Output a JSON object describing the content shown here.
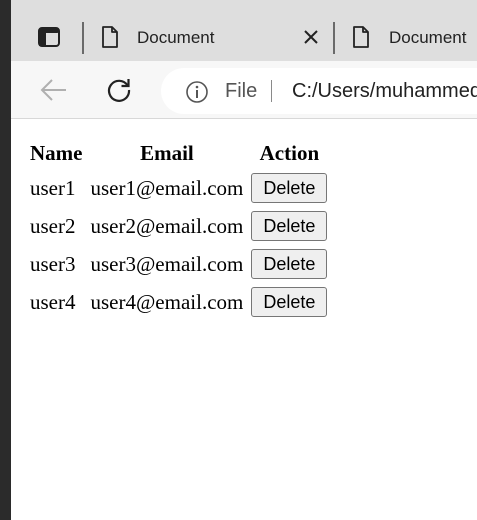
{
  "browser": {
    "tabs": [
      {
        "title": "Document"
      },
      {
        "title": "Document"
      }
    ],
    "address": {
      "scheme_label": "File",
      "url": "C:/Users/muhammed"
    }
  },
  "page": {
    "table": {
      "headers": [
        "Name",
        "Email",
        "Action"
      ],
      "rows": [
        {
          "name": "user1",
          "email": "user1@email.com",
          "action": "Delete"
        },
        {
          "name": "user2",
          "email": "user2@email.com",
          "action": "Delete"
        },
        {
          "name": "user3",
          "email": "user3@email.com",
          "action": "Delete"
        },
        {
          "name": "user4",
          "email": "user4@email.com",
          "action": "Delete"
        }
      ]
    }
  }
}
